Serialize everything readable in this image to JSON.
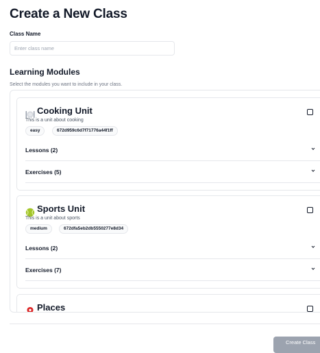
{
  "page": {
    "title": "Create a New Class"
  },
  "class_name": {
    "label": "Class Name",
    "placeholder": "Enter class name",
    "value": ""
  },
  "learning_modules": {
    "title": "Learning Modules",
    "description": "Select the modules you want to include in your class.",
    "modules": [
      {
        "icon": "plate-cutlery-icon",
        "title": "Cooking Unit",
        "subtitle": "This is a unit about cooking",
        "difficulty": "easy",
        "id": "672d959c6d7f71776a44f1ff",
        "lessons_label": "Lessons (2)",
        "exercises_label": "Exercises (5)",
        "selected": false
      },
      {
        "icon": "tennis-ball-icon",
        "title": "Sports Unit",
        "subtitle": "This is a unit about sports",
        "difficulty": "medium",
        "id": "672dfa5eb2db5550277e8d34",
        "lessons_label": "Lessons (2)",
        "exercises_label": "Exercises (7)",
        "selected": false
      },
      {
        "icon": "map-pin-icon",
        "title": "Places",
        "selected": false
      }
    ]
  },
  "actions": {
    "create_label": "Create Class"
  },
  "colors": {
    "text": "#111827",
    "muted": "#6b7280",
    "border": "#e5e7eb",
    "button_disabled": "#9ca3af",
    "ball": "#a3c629",
    "pin": "#dc2626"
  }
}
